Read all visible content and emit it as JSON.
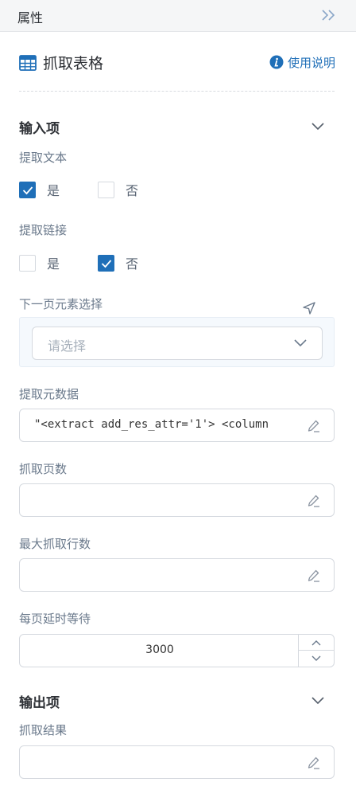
{
  "header": {
    "title": "属性"
  },
  "panel": {
    "title": "抓取表格",
    "help_label": "使用说明"
  },
  "inputs_section": {
    "title": "输入项",
    "extract_text": {
      "label": "提取文本",
      "options": [
        "是",
        "否"
      ],
      "selected": "是"
    },
    "extract_links": {
      "label": "提取链接",
      "options": [
        "是",
        "否"
      ],
      "selected": "否"
    },
    "next_page": {
      "label": "下一页元素选择",
      "placeholder": "请选择"
    },
    "metadata": {
      "label": "提取元数据",
      "value": "\"<extract add_res_attr='1'>  <column"
    },
    "page_count": {
      "label": "抓取页数",
      "value": ""
    },
    "max_rows": {
      "label": "最大抓取行数",
      "value": ""
    },
    "page_wait": {
      "label": "每页延时等待",
      "value": "3000"
    }
  },
  "outputs_section": {
    "title": "输出项",
    "result": {
      "label": "抓取结果",
      "value": ""
    }
  },
  "colors": {
    "accent": "#1f6fb8",
    "label": "#6b7a8c",
    "border": "#d5d9df"
  },
  "icons": {
    "collapse": "double-chevron-right-icon",
    "table": "table-icon",
    "help": "info-icon",
    "expand": "chevron-down-icon",
    "locate": "locate-arrow-icon",
    "edit": "pencil-icon"
  }
}
